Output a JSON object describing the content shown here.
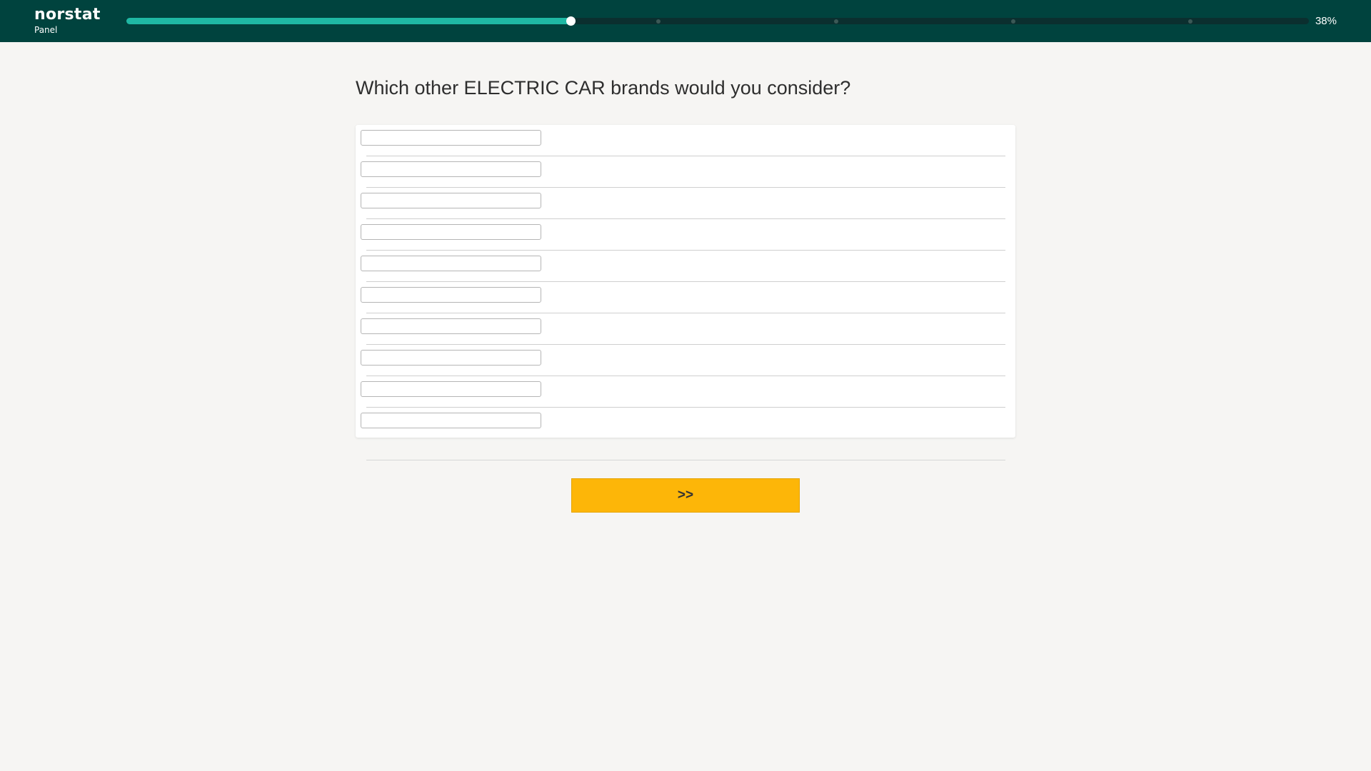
{
  "header": {
    "logo_name": "norstat",
    "logo_sub": "Panel",
    "progress_text": "38%",
    "progress_fraction": 0.376,
    "milestones": [
      0.45,
      0.6,
      0.75,
      0.9
    ],
    "background_color": "#00433e",
    "progress_color": "#1fb8a4"
  },
  "question": {
    "text": "Which other ELECTRIC CAR brands would you consider?"
  },
  "answers": {
    "fields": [
      {
        "value": ""
      },
      {
        "value": ""
      },
      {
        "value": ""
      },
      {
        "value": ""
      },
      {
        "value": ""
      },
      {
        "value": ""
      },
      {
        "value": ""
      },
      {
        "value": ""
      },
      {
        "value": ""
      },
      {
        "value": ""
      }
    ]
  },
  "navigation": {
    "next_label": ">>",
    "next_color": "#fdb608"
  }
}
